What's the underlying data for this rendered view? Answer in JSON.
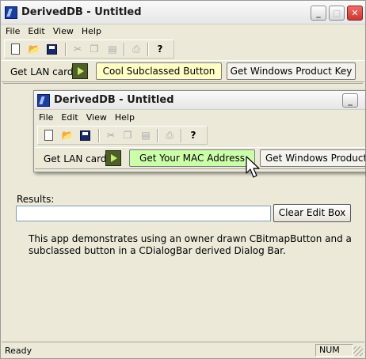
{
  "outer": {
    "title": "DerivedDB - Untitled",
    "controls": {
      "minimize": "_",
      "maximize": "□",
      "close": "✕"
    },
    "menu": [
      "File",
      "Edit",
      "View",
      "Help"
    ],
    "toolbar_icons": [
      "new-file-icon",
      "open-folder-icon",
      "save-disk-icon",
      "cut-icon",
      "copy-icon",
      "paste-icon",
      "print-icon",
      "help-icon"
    ],
    "dialogbar": {
      "label": "Get LAN card",
      "button1": "Cool Subclassed Button",
      "button2": "Get Windows Product Key"
    },
    "results_label": "Results:",
    "results_value": "",
    "clear_button": "Clear Edit Box",
    "description": "This app demonstrates using an owner drawn CBitmapButton and a subclassed button in a CDialogBar derived Dialog Bar.",
    "status": {
      "text": "Ready",
      "num": "NUM"
    }
  },
  "inner": {
    "title": "DerivedDB - Untitled",
    "controls": {
      "minimize": "_"
    },
    "menu": [
      "File",
      "Edit",
      "View",
      "Help"
    ],
    "dialogbar": {
      "label": "Get LAN card",
      "button1": "Get Your MAC Address",
      "button2": "Get Windows Product Key"
    }
  },
  "colors": {
    "yellow_button": "#ffffc6",
    "green_button": "#ccffaa",
    "close_red": "#c8392f"
  }
}
